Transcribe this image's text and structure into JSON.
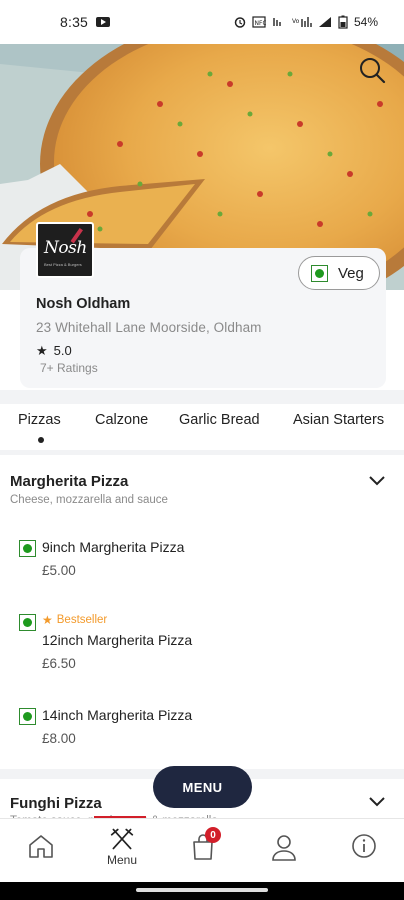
{
  "status_bar": {
    "time": "8:35",
    "battery": "54%",
    "icons": [
      "youtube-icon",
      "alarm-icon",
      "nfc-icon",
      "wifi-calling-icon",
      "wifi-icon",
      "signal-icon",
      "battery-icon"
    ]
  },
  "restaurant": {
    "logo_text": "Nosh",
    "logo_sub": "Best Pizza & Burgers",
    "name": "Nosh Oldham",
    "address": "23 Whitehall Lane Moorside, Oldham",
    "rating": "5.0",
    "rating_count": "7+ Ratings",
    "veg_label": "Veg"
  },
  "tabs": [
    {
      "label": "Pizzas",
      "active": true
    },
    {
      "label": "Calzone"
    },
    {
      "label": "Garlic Bread"
    },
    {
      "label": "Asian Starters"
    }
  ],
  "categories": [
    {
      "title": "Margherita Pizza",
      "description": "Cheese, mozzarella and sauce",
      "items": [
        {
          "name": "9inch Margherita Pizza",
          "price": "£5.00"
        },
        {
          "name": "12inch Margherita Pizza",
          "price": "£6.50",
          "badge": "Bestseller"
        },
        {
          "name": "14inch Margherita Pizza",
          "price": "£8.00"
        }
      ]
    },
    {
      "title": "Funghi Pizza",
      "description": "Tomato sauce, mushrooms & mozzarella"
    }
  ],
  "menu_button": "MENU",
  "bottom_nav": {
    "items": [
      {
        "icon": "home-icon"
      },
      {
        "icon": "menu-cutlery-icon",
        "label": "Menu",
        "active": true
      },
      {
        "icon": "cart-icon",
        "badge": "0"
      },
      {
        "icon": "profile-icon"
      },
      {
        "icon": "info-icon"
      }
    ]
  },
  "colors": {
    "accent_navy": "#1f2740",
    "veg_green": "#1e9a1e",
    "bestseller_orange": "#f39a2b",
    "badge_red": "#d21f2a"
  }
}
